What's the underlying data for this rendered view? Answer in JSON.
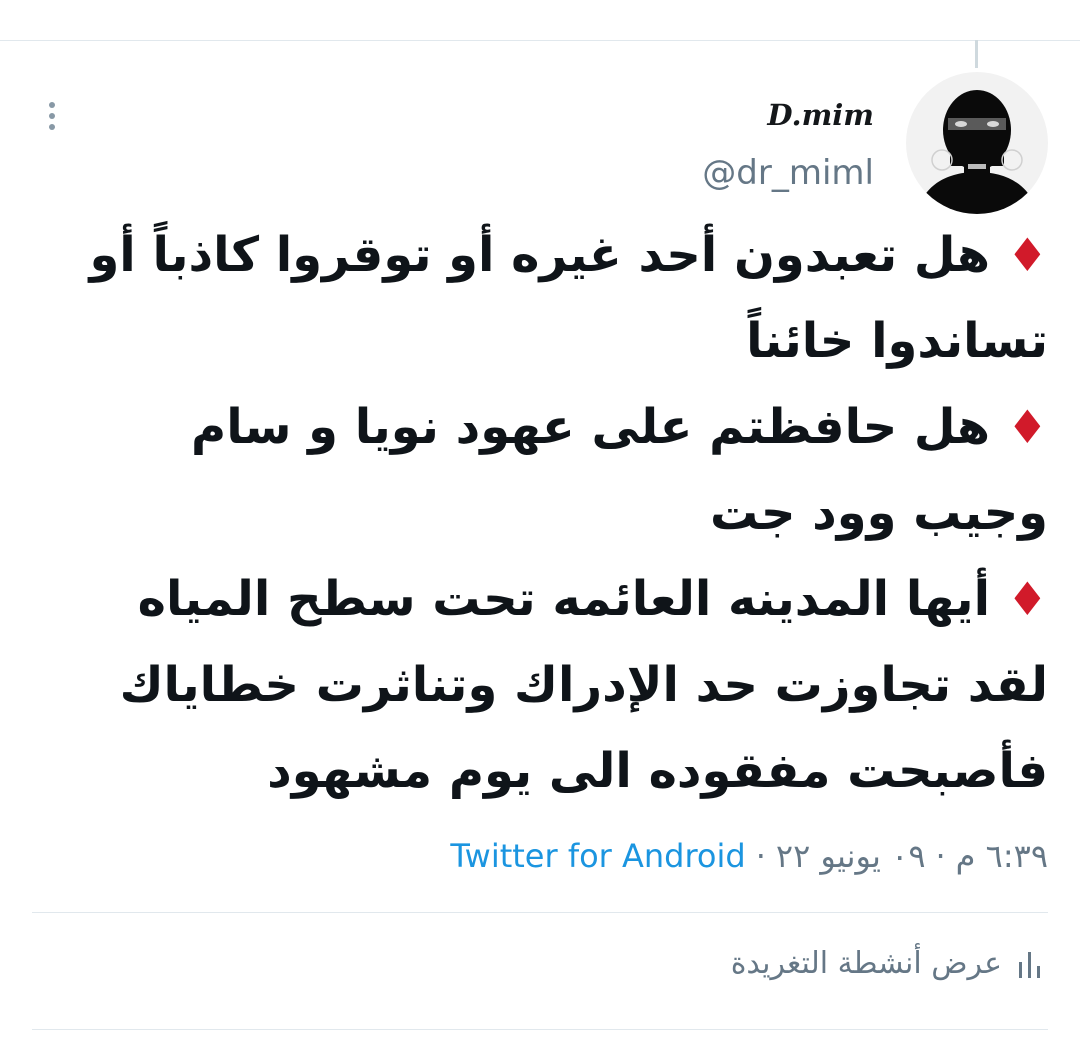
{
  "tweet": {
    "author": {
      "display_name": "D.mim",
      "handle": "@dr_miml",
      "avatar_icon": "avatar-photo"
    },
    "lines": [
      {
        "marker": "♦",
        "text": "هل تعبدون أحد غيره أو توقروا كاذباً أو تساندوا خائناً"
      },
      {
        "marker": "♦",
        "text": "هل حافظتم على عهود نويا و سام وجيب وود جت"
      },
      {
        "marker": "♦",
        "text": "أيها المدينه العائمه تحت سطح المياه لقد تجاوزت حد الإدراك وتناثرت خطاياك فأصبحت مفقوده الى يوم مشهود"
      }
    ],
    "time": "٦:٣٩ م",
    "date": "٠٩ يونيو ٢٢",
    "separator": "·",
    "source": "Twitter for Android"
  },
  "actions": {
    "view_activity_label": "عرض أنشطة التغريدة",
    "view_activity_icon": "bar-chart-icon",
    "more_icon": "more-vertical-icon"
  },
  "colors": {
    "link": "#1b95e0",
    "secondary_text": "#657786",
    "diamond": "#d11a2a",
    "divider": "#e1e8ed"
  }
}
